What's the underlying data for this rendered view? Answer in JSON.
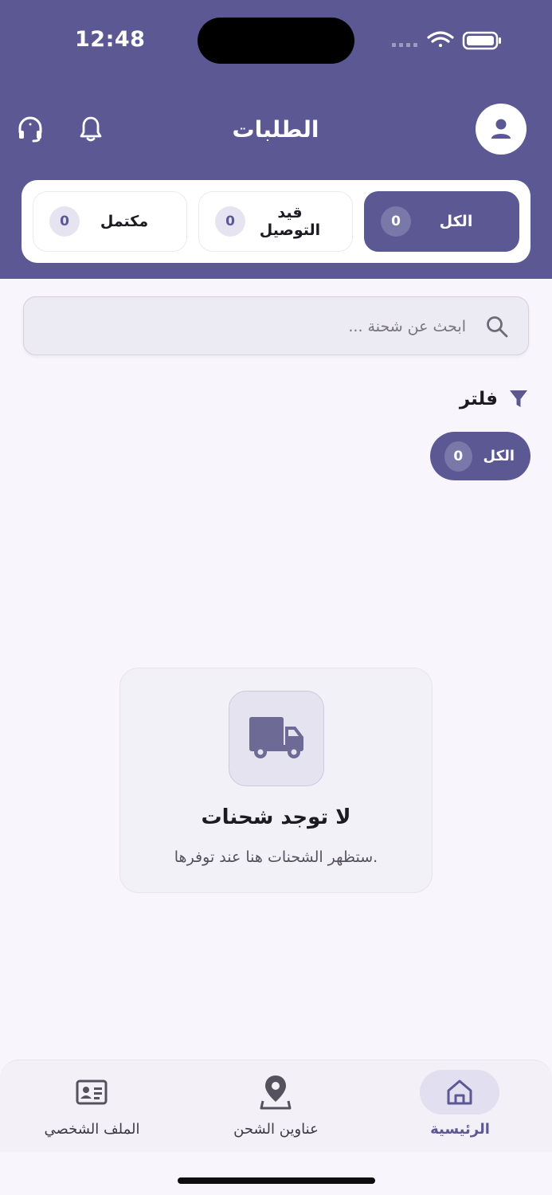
{
  "status_bar": {
    "time": "12:48"
  },
  "header": {
    "title": "الطلبات"
  },
  "tabs": [
    {
      "label": "الكل",
      "count": "0",
      "active": true
    },
    {
      "label": "قيد التوصيل",
      "count": "0",
      "active": false
    },
    {
      "label": "مكتمل",
      "count": "0",
      "active": false
    }
  ],
  "search": {
    "placeholder": "ابحث عن شحنة ..."
  },
  "filter": {
    "title": "فلتر",
    "chip_label": "الكل",
    "chip_count": "0"
  },
  "empty_state": {
    "title": "لا توجد شحنات",
    "subtitle": "ستظهر الشحنات هنا عند توفرها."
  },
  "bottom_nav": [
    {
      "label": "الرئيسية",
      "icon": "home-icon",
      "active": true
    },
    {
      "label": "عناوين الشحن",
      "icon": "location-pin-icon",
      "active": false
    },
    {
      "label": "الملف الشخصي",
      "icon": "id-card-icon",
      "active": false
    }
  ],
  "colors": {
    "primary": "#5b5894",
    "background": "#f8f6fc",
    "pill": "#e6e4f1"
  }
}
